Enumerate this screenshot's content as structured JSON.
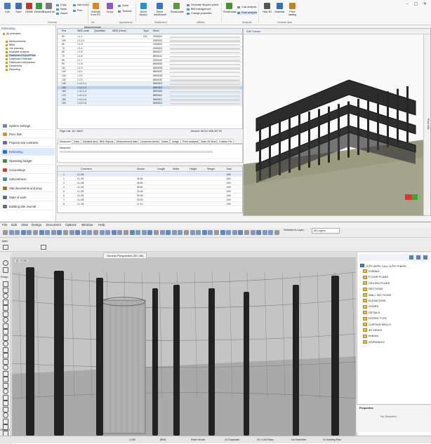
{
  "estimator": {
    "ribbon": {
      "buttons": [
        "Add",
        "Save",
        "Delete",
        "Refresh",
        "Expand all",
        "Undo",
        "Redo",
        "Indicate from IFC",
        "Group",
        "Appear...",
        "Direct deploy*",
        "Direct dashboard*",
        "Recalculate",
        "Recalculate",
        "Hide 3D",
        "Estimate",
        "Price catalog"
      ],
      "small": [
        "Copy",
        "Paste",
        "Import",
        "Add model",
        "Find",
        "Zoom",
        "Textures",
        "Generate Simplex prices",
        "BIM management",
        "Change properties",
        "Cost analysis",
        "Price analysis",
        "Filter",
        "Find",
        "Replace"
      ],
      "groups": [
        "General",
        "Go",
        "Appearance",
        "Dashboard",
        "Utilities",
        "Analysis",
        "General data"
      ]
    },
    "tree_label": "Estimating",
    "tree": [
      "All estimates",
      "Measurements",
      "BIMs",
      "Job planning",
      "Available analysis",
      "Dashboard Export/Pack",
      "Dashboard Estimate",
      "Dashboard comparison",
      "Documents",
      "Reporting"
    ],
    "nav": [
      "System Settings",
      "Price lists",
      "Projects and contracts",
      "Estimating",
      "Operating budget",
      "Accountings",
      "Subcontracts",
      "Site documents and prog",
      "State of work",
      "Building Site Journal"
    ],
    "grid_tab": "Measurements",
    "grid_headers": [
      "Pos",
      "WBS code",
      "Quantities",
      "WBS (Desc)",
      "Type",
      "Short"
    ],
    "grid_rows": [
      [
        "50",
        "1.1.1",
        "",
        "",
        "ZZZ",
        "3333001"
      ],
      [
        "100",
        "1.1.2.1",
        "",
        "",
        "",
        "0000020"
      ],
      [
        "80",
        "1.1.3",
        "",
        "",
        "",
        "3333002"
      ],
      [
        "70",
        "1.1.4",
        "",
        "",
        "",
        "3333003"
      ],
      [
        "60",
        "1.1.5",
        "",
        "",
        "",
        "8800027"
      ],
      [
        "70",
        "1.1.6",
        "",
        "",
        "",
        "8800011"
      ],
      [
        "80",
        "1.1.7",
        "",
        "",
        "",
        "0000020"
      ],
      [
        "90",
        "1.1.8",
        "",
        "",
        "",
        "8800025"
      ],
      [
        "110",
        "1.1.9",
        "",
        "",
        "",
        "8800025"
      ],
      [
        "100",
        "1.2.1",
        "",
        "",
        "",
        "8800030"
      ],
      [
        "120",
        "1.2.2",
        "",
        "",
        "",
        "8800038"
      ],
      [
        "130",
        "1.2.3",
        "",
        "",
        "",
        "8800030"
      ],
      [
        "140",
        "1.4.2.1.1",
        "",
        "",
        "",
        "8800303"
      ],
      [
        "150",
        "1.4.2.1.2",
        "",
        "",
        "",
        "8800303"
      ],
      [
        "160",
        "1.4.2.1.3",
        "",
        "",
        "",
        "8800305"
      ],
      [
        "170",
        "1.4.2.1.4",
        "",
        "",
        "",
        "8800302"
      ],
      [
        "180",
        "1.4.2.1.5",
        "",
        "",
        "",
        "8800301"
      ],
      [
        "190",
        "1.4.2.1.6",
        "",
        "",
        "",
        "8800303"
      ]
    ],
    "pager": "Page rule: 16  /  16/47",
    "amount": "Amount: 98,317,836,457.00",
    "bim_title": "BIM Viewer",
    "right_tab": "Price lists",
    "bottom_tabs": [
      "Measures",
      "Data",
      "Detailed item",
      "BIM Objects",
      "Measurement data",
      "Lumpsum works",
      "Notes",
      "Image",
      "Price analysis",
      "Stato Of Work",
      "Custom Fie"
    ],
    "measure_label": "Measures",
    "qty_headers": [
      "",
      "Comment",
      "Similar",
      "Length",
      "Width",
      "Height",
      "Weight",
      "Total"
    ],
    "qty_rows": [
      [
        "1",
        "CL-08",
        "",
        "",
        "",
        "",
        "",
        ".000"
      ],
      [
        "2",
        "CL-09",
        "26.60",
        "",
        "",
        "",
        "",
        ".000"
      ],
      [
        "3",
        "CL-08",
        "26.60",
        "",
        "",
        "",
        "",
        ".000"
      ],
      [
        "4",
        "CL-09",
        "28.60",
        "",
        "",
        "",
        "",
        ".000"
      ],
      [
        "5",
        "CL-09",
        "20.04",
        "",
        "",
        "",
        "",
        ".000"
      ],
      [
        "6",
        "CL-09",
        "25.99",
        "",
        "",
        "",
        "",
        ".000"
      ],
      [
        "7",
        "CL-08",
        "20.30",
        "",
        "",
        "",
        "",
        ".000"
      ],
      [
        "8",
        "CL-08",
        "27.10",
        "",
        "",
        "",
        "",
        ".000"
      ]
    ]
  },
  "archicad": {
    "menu": [
      "File",
      "Edit",
      "View",
      "Design",
      "Document",
      "Options",
      "Window",
      "Help"
    ],
    "info_label": "Main",
    "view_tab": "Generic Perspective (3D / All)",
    "toolbox_sections": [
      "Design",
      "Viewpoint"
    ],
    "coord": "(0, +3.40)",
    "selection_label": "Selection's Layer:",
    "layer_value": "All Layers",
    "navigator_root": "مجموعه تجاری پروژه مجتمع تجاری",
    "navigator": [
      "ZONING",
      "FLOOR PLANS",
      "CEILING PLANS",
      "SECTIONS",
      "WALL SECTIONS",
      "ELEVATIONS",
      "STAIRS",
      "DETAILS",
      "DOORS TYPE",
      "CURTAIN WALLS",
      "3D VIEWS",
      "Indexes",
      "WORKING!!!"
    ],
    "properties_title": "Properties",
    "properties_empty": "No Selection",
    "status": {
      "scale": "1:100",
      "layer": "[BIM]",
      "model": "Entire Model",
      "pen": "10 Grayscale",
      "plan": "20 1:100 Planc",
      "override": "No Overrides",
      "story": "01 Existing Plan"
    }
  },
  "colors": {
    "accent": "#1a56b0",
    "selection": "#b8d2f0",
    "folder": "#e7b84f",
    "ground": "#9a9a80"
  }
}
